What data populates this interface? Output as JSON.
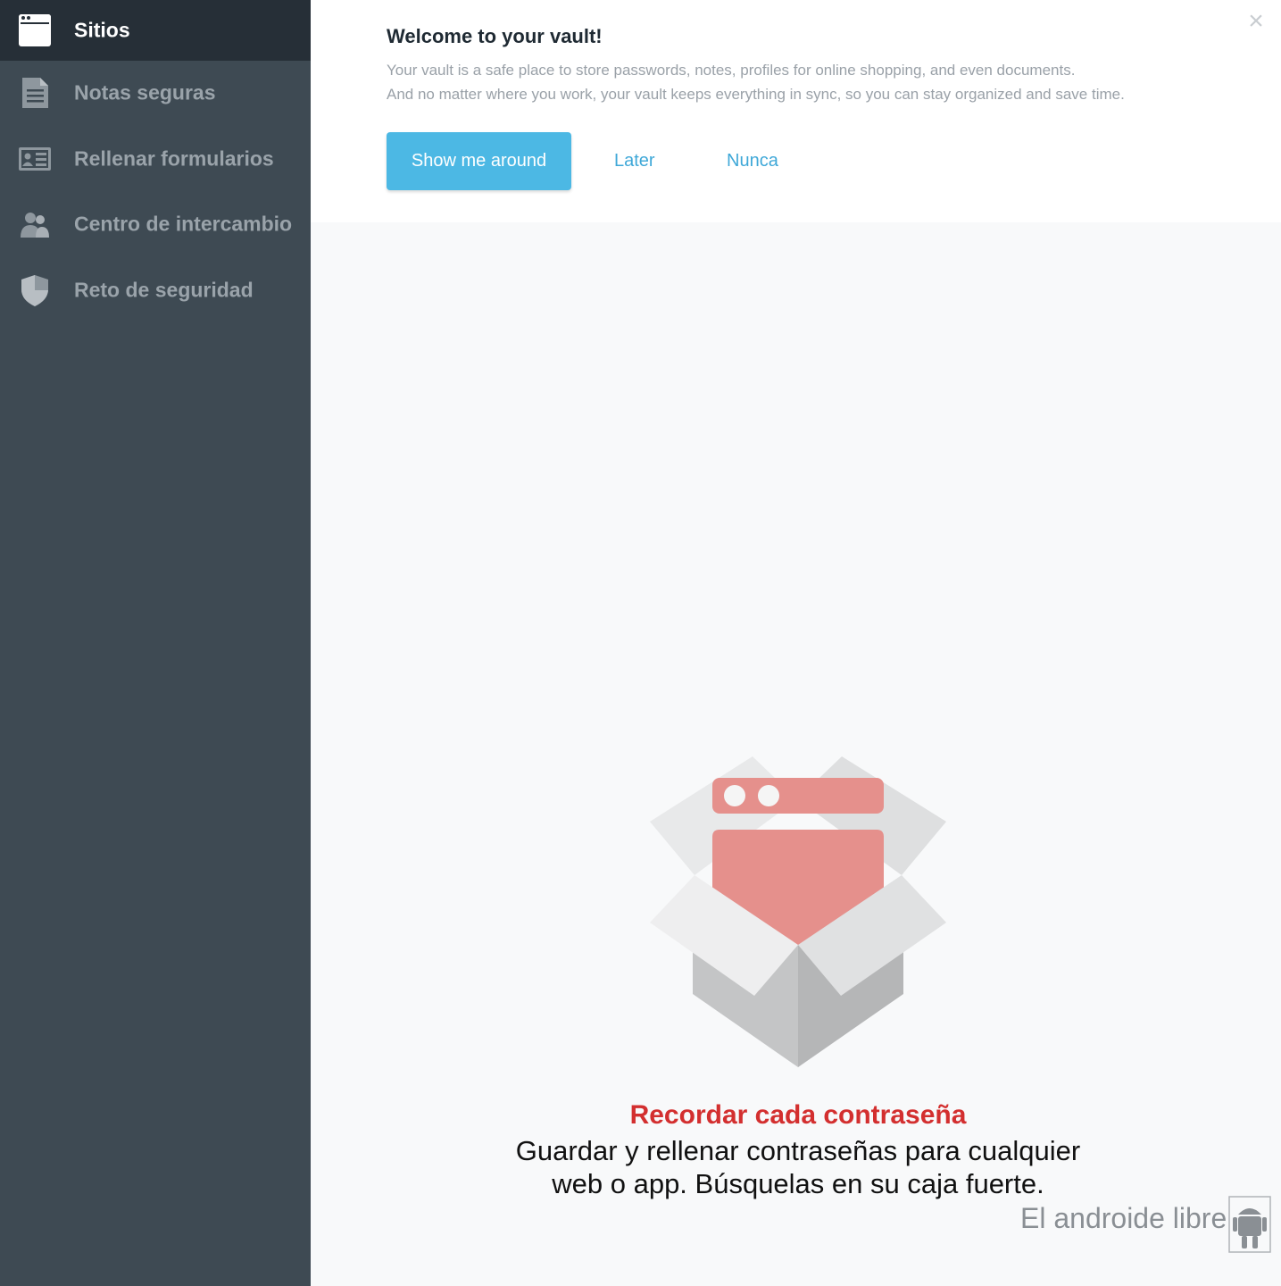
{
  "sidebar": {
    "items": [
      {
        "label": "Sitios",
        "icon": "browser-window-icon",
        "active": true
      },
      {
        "label": "Notas seguras",
        "icon": "note-document-icon",
        "active": false
      },
      {
        "label": "Rellenar formularios",
        "icon": "id-card-icon",
        "active": false
      },
      {
        "label": "Centro de intercambio",
        "icon": "users-icon",
        "active": false
      },
      {
        "label": "Reto de seguridad",
        "icon": "shield-icon",
        "active": false
      }
    ]
  },
  "welcome": {
    "title": "Welcome to your vault!",
    "line1": "Your vault is a safe place to store passwords, notes, profiles for online shopping, and even documents.",
    "line2": "And no matter where you work, your vault keeps everything in sync, so you can stay organized and save time.",
    "show_me_label": "Show me around",
    "later_label": "Later",
    "never_label": "Nunca",
    "close_label": "×"
  },
  "empty_state": {
    "title": "Recordar cada contraseña",
    "description": "Guardar y rellenar contraseñas para cualquier web o app. Búsquelas en su caja fuerte."
  },
  "watermark": {
    "text": "El androide libre"
  },
  "colors": {
    "sidebar_bg": "#3e4a53",
    "sidebar_active_bg": "#262f37",
    "accent_blue": "#4cb8e4",
    "link_blue": "#3fa8d8",
    "title_red": "#d32f2f",
    "illustration_red": "#e5908c"
  }
}
